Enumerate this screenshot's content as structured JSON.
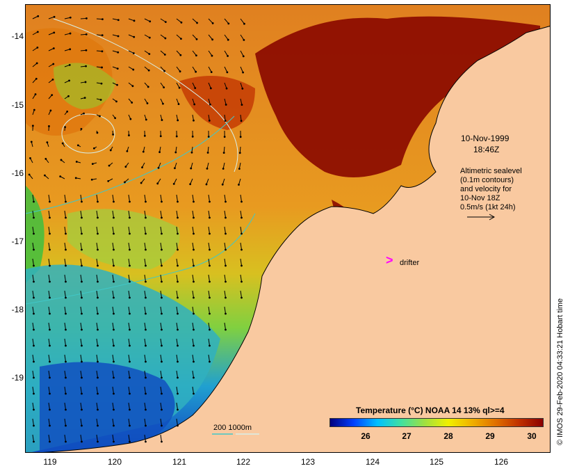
{
  "map": {
    "y_axis_labels": [
      "-14",
      "-15",
      "-16",
      "-17",
      "-18",
      "-19"
    ],
    "x_axis_labels": [
      "119",
      "120",
      "121",
      "122",
      "123",
      "124",
      "125",
      "126"
    ],
    "colors": {
      "land": "#f9c9a0",
      "coastline": "#000000",
      "contour": "#d8f0ea",
      "arrow": "#000000",
      "drifter": "#ff00ff"
    }
  },
  "annotations": {
    "date": "10-Nov-1999",
    "time": "18:46Z",
    "altimetry_lines": [
      "Altimetric sealevel",
      "(0.1m contours)",
      "and velocity for",
      "10-Nov 18Z",
      "0.5m/s (1kt 24h)"
    ],
    "drifter_label": "drifter",
    "drifter_symbol": ">",
    "bathymetry_label": "200  1000m",
    "credit": "© IMOS 29-Feb-2020 04:33:21 Hobart time"
  },
  "legend": {
    "title": "Temperature (°C) NOAA 14 13% ql>=4",
    "ticks": [
      "26",
      "27",
      "28",
      "29",
      "30"
    ],
    "gradient": [
      "#00007f",
      "#0040ff",
      "#00c0ff",
      "#40e0a0",
      "#a0e040",
      "#f0f000",
      "#f0b000",
      "#e07000",
      "#c03000",
      "#8b0000"
    ]
  }
}
